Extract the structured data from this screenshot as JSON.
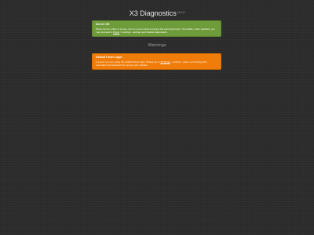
{
  "header": {
    "title": "X3 Diagnostics",
    "version": "v1.0.0"
  },
  "server_status": {
    "title": "Server OK",
    "text_1": "Plesk can be a little of issues, but we recommend resolving the warnings below. If possible, when satisfied, you may proceed to ",
    "link_label": "Panel",
    "text_2": " > settings - settings and disable diagnostics."
  },
  "warnings_heading": "Warnings",
  "warnings": [
    {
      "title": "Default Panel Login",
      "text_1": "It seems you are using the default Panel login. Please go to ",
      "link_label": "X3 Panel",
      "text_2": " - settings - panel, and change the username and password to secure your website."
    }
  ],
  "colors": {
    "background": "#2c2c2c",
    "success": "#6f9c3a",
    "warning": "#f07d0a"
  }
}
